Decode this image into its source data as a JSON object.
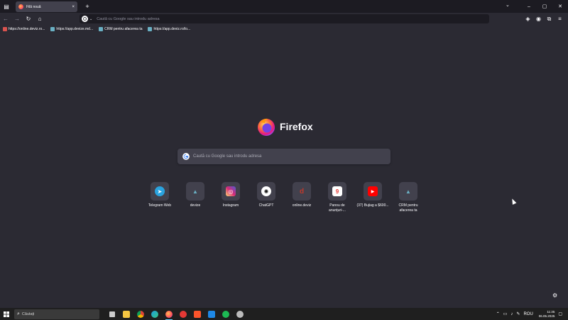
{
  "colors": {
    "background": "#2b2a33",
    "tab_strip": "#1c1b22",
    "tile": "#42414d",
    "accent_focus": "#60cdff"
  },
  "tab": {
    "title": "Filă nouă",
    "close_label": "×",
    "new_tab_label": "+"
  },
  "window": {
    "minimize": "–",
    "maximize": "▢",
    "close": "✕",
    "tabs_dropdown": "⌄"
  },
  "urlbar": {
    "placeholder": "Caută cu Google sau introdu adresa"
  },
  "bookmarks": [
    {
      "label": "https://online.deviz.ro...",
      "color": "#d9534f"
    },
    {
      "label": "https://app.devize.md...",
      "color": "#6ab0c4"
    },
    {
      "label": "CRM pentru afacerea ta",
      "color": "#6ab0c4"
    },
    {
      "label": "https://app.deviz.ro/lo...",
      "color": "#6ab0c4"
    }
  ],
  "brand": {
    "name": "Firefox"
  },
  "search": {
    "placeholder": "Caută cu Google sau introdu adresa"
  },
  "shortcuts": [
    {
      "label": "Telegram Web",
      "icon": "telegram-icon",
      "color": "#2aa3df",
      "glyph": "➤"
    },
    {
      "label": "devize",
      "icon": "devize-icon",
      "color": "#6ab0c4",
      "glyph": "▲"
    },
    {
      "label": "Instagram",
      "icon": "instagram-icon",
      "color": "#d6249f",
      "glyph": "◎"
    },
    {
      "label": "ChatGPT",
      "icon": "chatgpt-icon",
      "color": "#ffffff",
      "glyph": "✺"
    },
    {
      "label": "online.deviz",
      "icon": "online-deviz-icon",
      "color": "#c0392b",
      "glyph": "d"
    },
    {
      "label": "Panou de anunțuri-...",
      "icon": "panou-icon",
      "color": "#ffffff",
      "glyph": "9"
    },
    {
      "label": "(37) Bujiag a $600...",
      "icon": "youtube-icon",
      "color": "#ff0000",
      "glyph": "▶"
    },
    {
      "label": "CRM pentru afacerea ta",
      "icon": "crm-icon",
      "color": "#6ab0c4",
      "glyph": "▲"
    }
  ],
  "taskbar": {
    "search_placeholder": "Căutați",
    "apps": [
      {
        "icon": "task-view-icon",
        "color": "#cccccc",
        "active": false
      },
      {
        "icon": "file-explorer-icon",
        "color": "#f4c542",
        "active": false
      },
      {
        "icon": "chrome-icon",
        "color": "#4caf50",
        "active": false
      },
      {
        "icon": "edge-icon",
        "color": "#1fa0e0",
        "active": false
      },
      {
        "icon": "firefox-icon",
        "color": "#ff7139",
        "active": true
      },
      {
        "icon": "opera-icon",
        "color": "#e53935",
        "active": false
      },
      {
        "icon": "brave-icon",
        "color": "#fb542b",
        "active": false
      },
      {
        "icon": "app-icon",
        "color": "#1e88e5",
        "active": false
      },
      {
        "icon": "spotify-icon",
        "color": "#1db954",
        "active": false
      },
      {
        "icon": "settings-icon",
        "color": "#bbbbbb",
        "active": false
      }
    ],
    "language": "ROU",
    "time": "11:35",
    "date": "06.05.2025"
  }
}
